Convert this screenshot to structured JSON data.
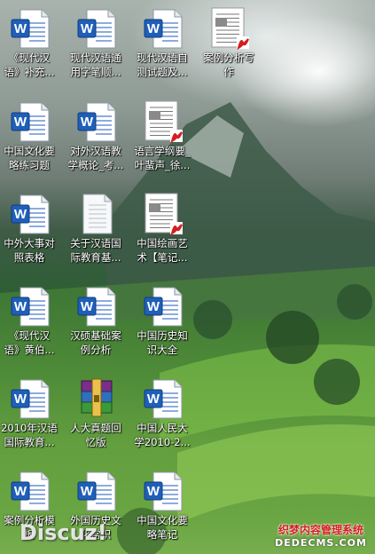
{
  "desktop": {
    "icons": [
      {
        "label": "《现代汉\n语》补充...",
        "type": "word"
      },
      {
        "label": "现代汉语通\n用字笔顺...",
        "type": "word"
      },
      {
        "label": "现代汉语自\n测试题及...",
        "type": "word"
      },
      {
        "label": "案例分析写\n作",
        "type": "pdf"
      },
      {
        "label": "中国文化要\n略练习题",
        "type": "word"
      },
      {
        "label": "对外汉语教\n学概论_考...",
        "type": "word"
      },
      {
        "label": "语言学纲要_\n叶蜚声_徐...",
        "type": "pdf"
      },
      {
        "label": "中外大事对\n照表格",
        "type": "word"
      },
      {
        "label": "关于汉语国\n际教育基...",
        "type": "doc"
      },
      {
        "label": "中国绘画艺\n术【笔记...",
        "type": "pdf"
      },
      {
        "label": "《现代汉\n语》黄伯...",
        "type": "word"
      },
      {
        "label": "汉硕基础案\n例分析",
        "type": "word"
      },
      {
        "label": "中国历史知\n识大全",
        "type": "word"
      },
      {
        "label": "2010年汉语\n国际教育...",
        "type": "word"
      },
      {
        "label": "人大真题回\n忆版",
        "type": "rar"
      },
      {
        "label": "中国人民大\n学2010-2...",
        "type": "word"
      },
      {
        "label": "案例分析模\n板",
        "type": "word"
      },
      {
        "label": "外国历史文\n化常识",
        "type": "word"
      },
      {
        "label": "中国文化要\n略笔记",
        "type": "word"
      }
    ]
  },
  "watermarks": {
    "discuz": "Discuz!",
    "site_cn": "织梦内容管理系统",
    "site_url": "DEDECMS.COM"
  },
  "colors": {
    "label_text": "#ffffff",
    "word_blue": "#1f5fb8",
    "pdf_red": "#d21f1f"
  }
}
